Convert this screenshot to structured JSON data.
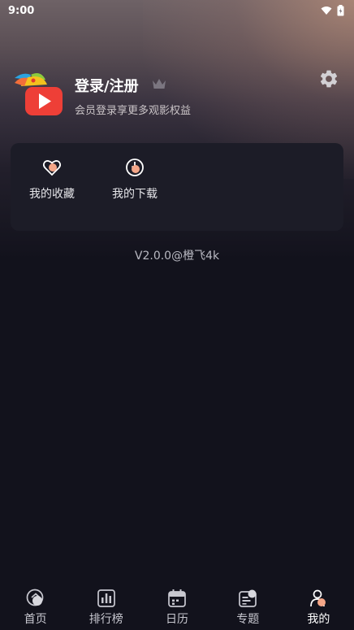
{
  "status_bar": {
    "time": "9:00"
  },
  "profile": {
    "title": "登录/注册",
    "subtitle": "会员登录享更多观影权益"
  },
  "quick_actions": [
    {
      "label": "我的收藏",
      "icon": "heart-icon"
    },
    {
      "label": "我的下载",
      "icon": "download-icon"
    }
  ],
  "version": "V2.0.0@橙飞4k",
  "tabbar": {
    "active": "我的",
    "items": [
      {
        "label": "首页",
        "icon": "home-icon"
      },
      {
        "label": "排行榜",
        "icon": "chart-icon"
      },
      {
        "label": "日历",
        "icon": "calendar-icon"
      },
      {
        "label": "专题",
        "icon": "topic-icon"
      },
      {
        "label": "我的",
        "icon": "profile-icon"
      }
    ]
  },
  "colors": {
    "background": "#12121c",
    "card": "#1c1c27",
    "accent": "#f4a688"
  }
}
